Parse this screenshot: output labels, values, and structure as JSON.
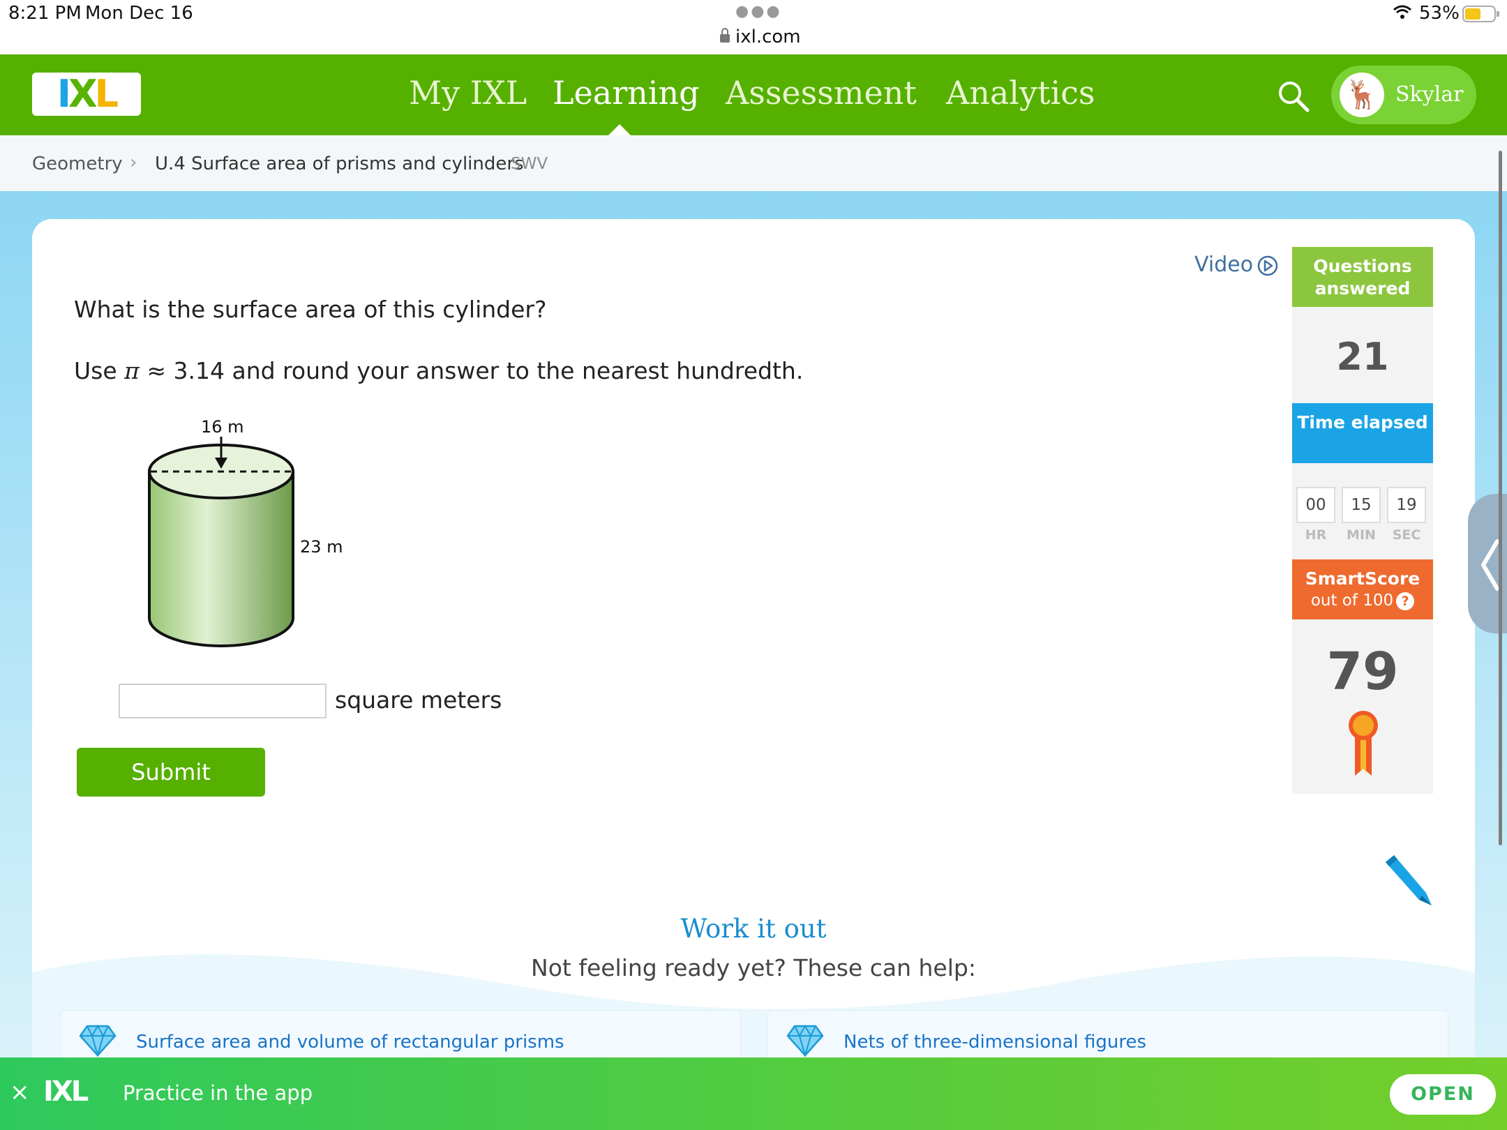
{
  "status_bar": {
    "time": "8:21 PM",
    "date": "Mon Dec 16",
    "url": "ixl.com",
    "battery": "53%"
  },
  "header": {
    "logo_text": "IXL",
    "nav": [
      "My IXL",
      "Learning",
      "Assessment",
      "Analytics"
    ],
    "active_nav": "Learning",
    "user_name": "Skylar",
    "brand_color": "#56b000"
  },
  "breadcrumb": {
    "subject": "Geometry",
    "skill": "U.4 Surface area of prisms and cylinders",
    "code": "SWV"
  },
  "question": {
    "video_label": "Video",
    "prompt": "What is the surface area of this cylinder?",
    "instruction_pre": "Use",
    "pi_symbol": "π",
    "instruction_post": "≈ 3.14 and round your answer to the nearest hundredth.",
    "diameter_label": "16 m",
    "height_label": "23 m",
    "answer_value": "",
    "answer_unit": "square meters",
    "submit_label": "Submit"
  },
  "sidebar": {
    "questions_answered_label": "Questions answered",
    "questions_answered": "21",
    "time_elapsed_label": "Time elapsed",
    "time": {
      "hr": "00",
      "min": "15",
      "sec": "19"
    },
    "time_units": {
      "hr": "HR",
      "min": "MIN",
      "sec": "SEC"
    },
    "smartscore_label": "SmartScore",
    "smartscore_sub": "out of 100",
    "smartscore_help": "?",
    "smartscore": "79"
  },
  "work_it_out": {
    "title": "Work it out",
    "subtitle": "Not feeling ready yet? These can help:",
    "links": [
      "Surface area and volume of rectangular prisms",
      "Nets of three-dimensional figures"
    ]
  },
  "app_banner": {
    "close": "×",
    "logo": "IXL",
    "text": "Practice in the app",
    "button": "OPEN"
  }
}
